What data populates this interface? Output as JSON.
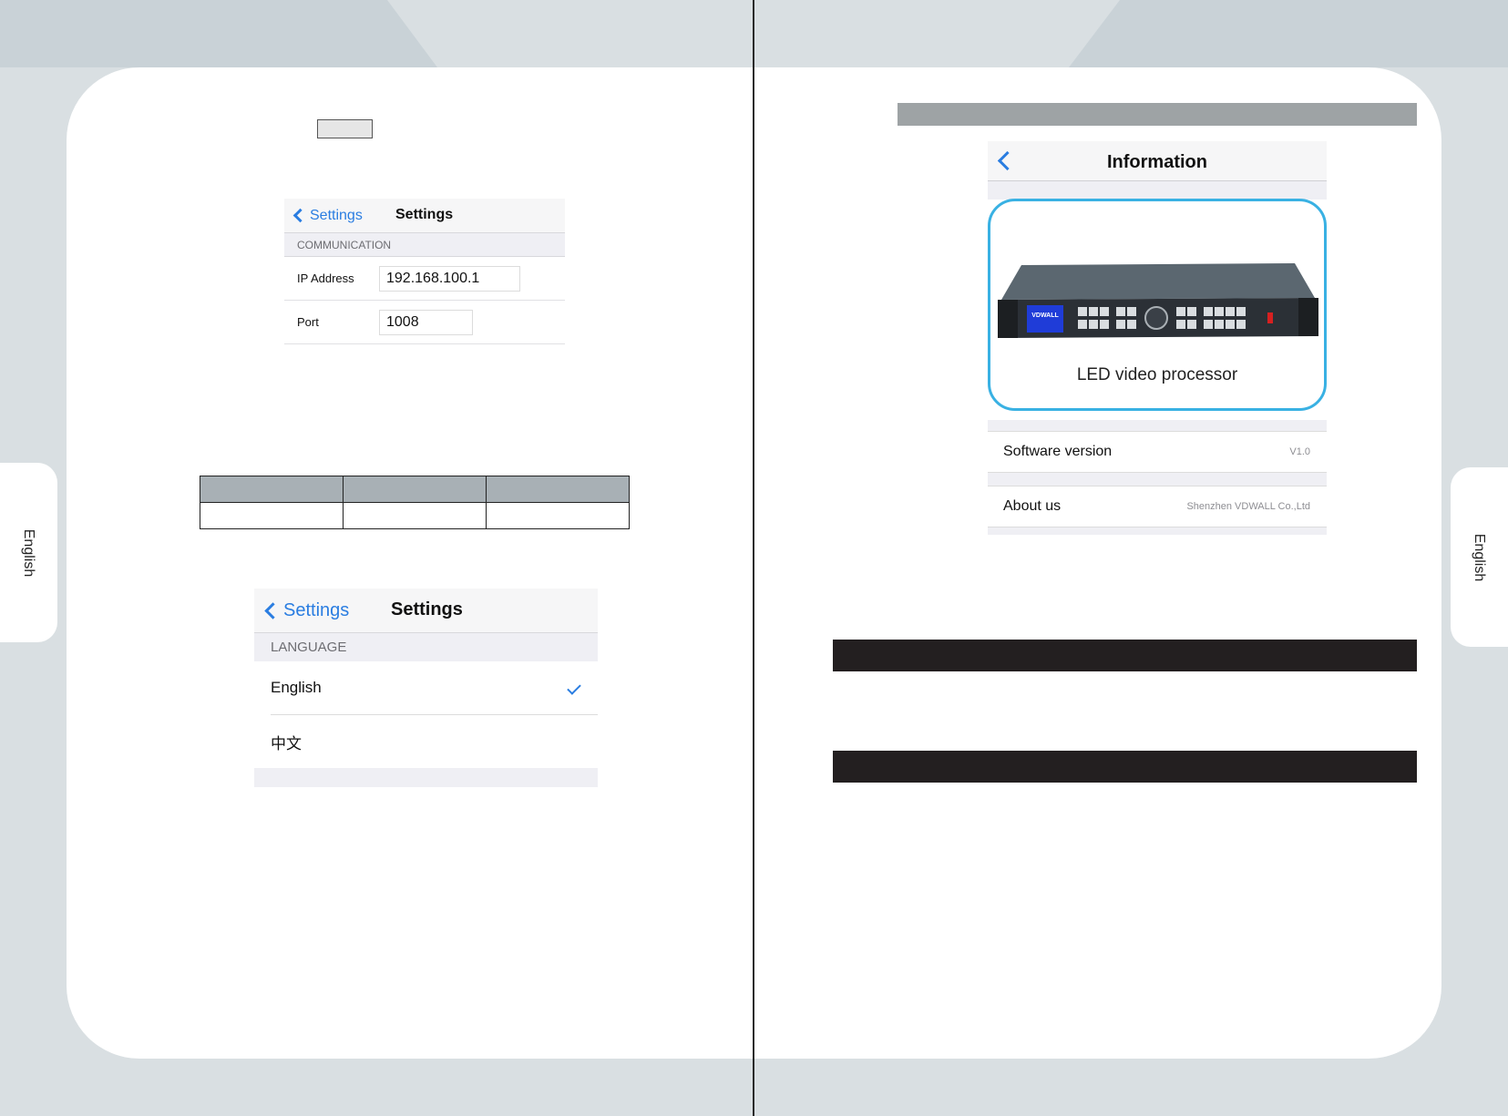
{
  "side_tab": {
    "left_label": "English",
    "right_label": "English"
  },
  "communication_screen": {
    "back_label": "Settings",
    "title": "Settings",
    "section": "COMMUNICATION",
    "ip_label": "IP Address",
    "ip_value": "192.168.100.1",
    "port_label": "Port",
    "port_value": "1008"
  },
  "language_screen": {
    "back_label": "Settings",
    "title": "Settings",
    "section": "LANGUAGE",
    "options": [
      {
        "label": "English",
        "selected": true
      },
      {
        "label": "中文",
        "selected": false
      }
    ]
  },
  "information_screen": {
    "title": "Information",
    "product_caption": "LED video processor",
    "device_brand": "VDWALL",
    "rows": [
      {
        "label": "Software version",
        "value": "V1.0"
      },
      {
        "label": "About us",
        "value": "Shenzhen VDWALL Co.,Ltd"
      }
    ]
  },
  "colors": {
    "accent": "#2a7de1",
    "card_border": "#39b1e3",
    "table_header": "#a8b0b5",
    "bar_dark": "#231f20"
  }
}
